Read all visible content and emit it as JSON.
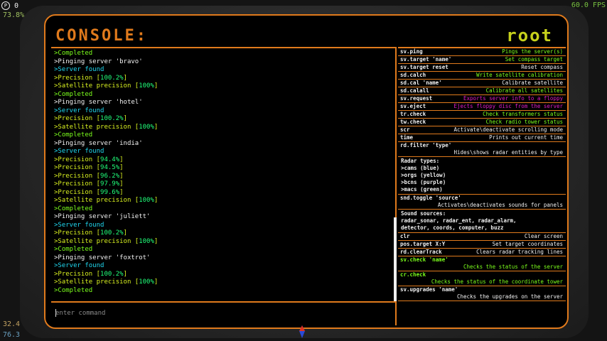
{
  "hud": {
    "top_left_icon": "P",
    "top_left_value": "0",
    "perc": "73.8%",
    "fps": "60.0 FPS",
    "bottom_left_1": "32.4",
    "bottom_left_2": "76.3"
  },
  "console": {
    "title": "CONSOLE:",
    "user": "root",
    "placeholder": "enter command"
  },
  "log": [
    {
      "text": ">Completed",
      "color": "green"
    },
    {
      "text": ">Pinging server 'bravo'",
      "color": "white"
    },
    {
      "text": ">Server found",
      "color": "cyan"
    },
    {
      "text": ">Precision [100.2%]",
      "color": "yellow"
    },
    {
      "text": ">Satellite precision [100%]",
      "color": "yellow"
    },
    {
      "text": ">Completed",
      "color": "green"
    },
    {
      "text": ">Pinging server 'hotel'",
      "color": "white"
    },
    {
      "text": ">Server found",
      "color": "cyan"
    },
    {
      "text": ">Precision [100.2%]",
      "color": "yellow"
    },
    {
      "text": ">Satellite precision [100%]",
      "color": "yellow"
    },
    {
      "text": ">Completed",
      "color": "green"
    },
    {
      "text": ">Pinging server 'india'",
      "color": "white"
    },
    {
      "text": ">Server found",
      "color": "cyan"
    },
    {
      "text": ">Precision [94.4%]",
      "color": "yellow"
    },
    {
      "text": ">Precision [94.5%]",
      "color": "yellow"
    },
    {
      "text": ">Precision [96.2%]",
      "color": "yellow"
    },
    {
      "text": ">Precision [97.9%]",
      "color": "yellow"
    },
    {
      "text": ">Precision [99.6%]",
      "color": "yellow"
    },
    {
      "text": ">Satellite precision [100%]",
      "color": "yellow"
    },
    {
      "text": ">Completed",
      "color": "green"
    },
    {
      "text": ">Pinging server 'juliett'",
      "color": "white"
    },
    {
      "text": ">Server found",
      "color": "cyan"
    },
    {
      "text": ">Precision [100.2%]",
      "color": "yellow"
    },
    {
      "text": ">Satellite precision [100%]",
      "color": "yellow"
    },
    {
      "text": ">Completed",
      "color": "green"
    },
    {
      "text": ">Pinging server 'foxtrot'",
      "color": "white"
    },
    {
      "text": ">Server found",
      "color": "cyan"
    },
    {
      "text": ">Precision [100.2%]",
      "color": "yellow"
    },
    {
      "text": ">Satellite precision [100%]",
      "color": "yellow"
    },
    {
      "text": ">Completed",
      "color": "green"
    }
  ],
  "help": [
    {
      "cmd": "sv.ping",
      "desc": "Pings the server(s)",
      "desc_color": "green",
      "tall": false
    },
    {
      "cmd": "sv.target 'name'",
      "desc": "Set compass target",
      "desc_color": "green",
      "tall": false
    },
    {
      "cmd": "sv.target reset",
      "desc": "Reset compass",
      "desc_color": "white",
      "tall": false
    },
    {
      "cmd": "sd.calch",
      "desc": "Write satellite calibration",
      "desc_color": "green",
      "tall": false
    },
    {
      "cmd": "sd.cal 'name'",
      "desc": "Calibrate satellite",
      "desc_color": "white",
      "tall": false
    },
    {
      "cmd": "sd.calall",
      "desc": "Calibrate all satellites",
      "desc_color": "green",
      "tall": false
    },
    {
      "cmd": "sv.request",
      "desc": "Exports server info to a floppy",
      "desc_color": "magenta",
      "tall": false
    },
    {
      "cmd": "sv.eject",
      "desc": "Ejects floppy disc from the server",
      "desc_color": "magenta",
      "tall": false
    },
    {
      "cmd": "tr.check",
      "desc": "Check transformers status",
      "desc_color": "green",
      "tall": false
    },
    {
      "cmd": "tw.check",
      "desc": "Check radio tower status",
      "desc_color": "green",
      "tall": false
    },
    {
      "cmd": "scr",
      "desc": "Activate\\deactivate scrolling mode",
      "desc_color": "white",
      "tall": false
    },
    {
      "cmd": "time",
      "desc": "Prints out current time",
      "desc_color": "white",
      "tall": false
    },
    {
      "cmd": "rd.filter 'type'",
      "desc": "Hides\\shows radar entities by type",
      "desc_color": "white",
      "tall": true
    }
  ],
  "radar_box": {
    "lines": [
      "Radar types:",
      ">cams (blue)",
      ">orgs (yellow)",
      ">bcns (purple)",
      ">macs (green)"
    ]
  },
  "help2": [
    {
      "cmd": "snd.toggle 'source'",
      "desc": "Activates\\deactivates sounds for panels",
      "desc_color": "white",
      "tall": true
    }
  ],
  "sound_box": {
    "lines": [
      "Sound sources:",
      "radar_sonar, radar_ent, radar_alarm,",
      "detector, coords, computer, buzz"
    ]
  },
  "help3": [
    {
      "cmd": "clr",
      "desc": "Clear screen",
      "desc_color": "white",
      "tall": false
    },
    {
      "cmd": "pos.target X:Y",
      "desc": "Set target  coordinates",
      "desc_color": "white",
      "tall": false
    },
    {
      "cmd": "rd.clearTrack",
      "desc": "Clears radar tracking lines",
      "desc_color": "white",
      "tall": false
    },
    {
      "cmd": "sv.check 'name'",
      "desc": "Checks the status of the server",
      "desc_color": "green",
      "tall": true,
      "cmd_color": "green"
    },
    {
      "cmd": "cr.check",
      "desc": "Checks the status of the coordinate tower",
      "desc_color": "green",
      "tall": true,
      "cmd_color": "green"
    },
    {
      "cmd": "sv.upgrades 'name'",
      "desc": "Checks the upgrades on the server",
      "desc_color": "white",
      "tall": true
    }
  ]
}
